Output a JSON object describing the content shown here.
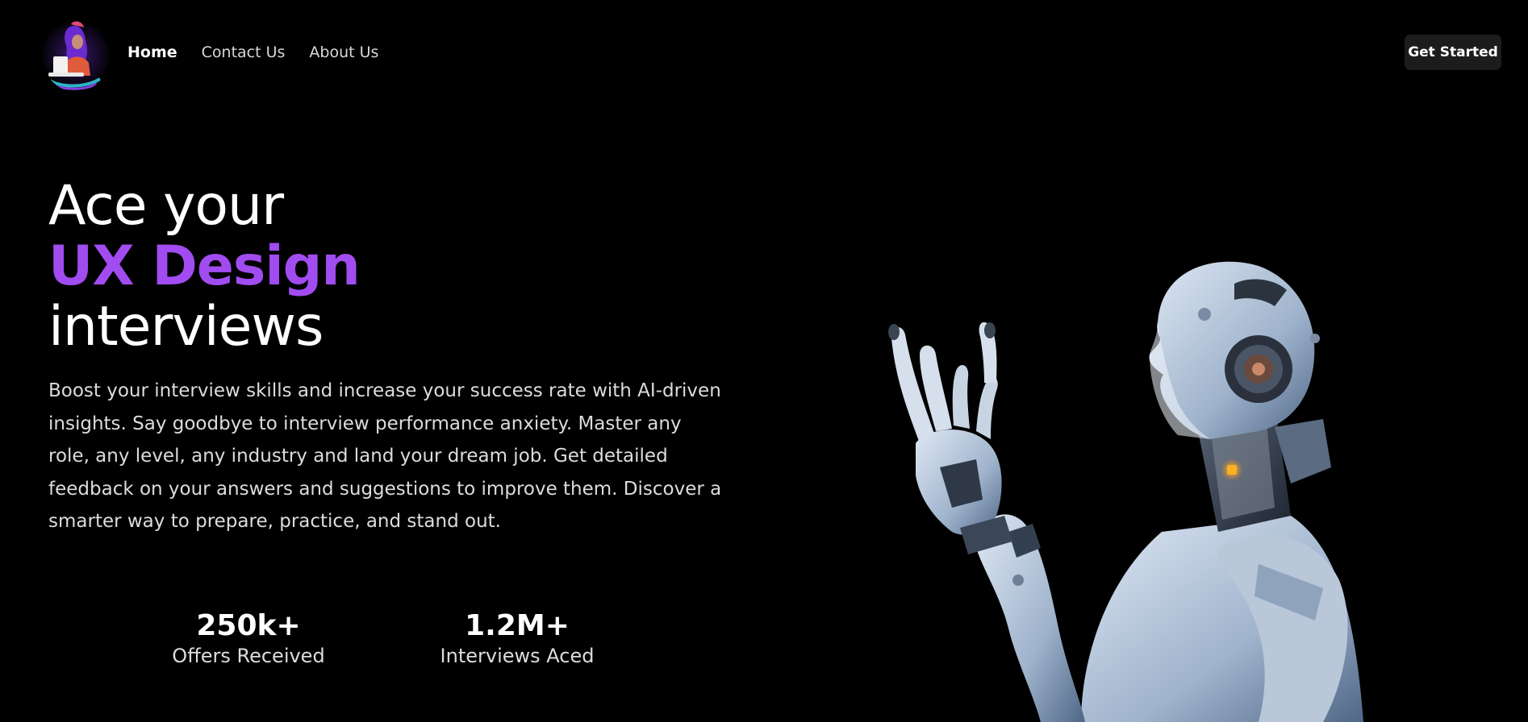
{
  "header": {
    "logo_icon": "woman-at-laptop-logo-icon",
    "nav": [
      {
        "label": "Home",
        "active": true
      },
      {
        "label": "Contact Us",
        "active": false
      },
      {
        "label": "About Us",
        "active": false
      }
    ],
    "cta_label": "Get Started"
  },
  "hero": {
    "headline_line1": "Ace your",
    "headline_line2": "UX Design",
    "headline_line3": "interviews",
    "description": "Boost your interview skills and increase your success rate with AI-driven insights. Say goodbye to interview performance anxiety. Master any role, any level, any industry and land your dream job. Get detailed feedback on your answers and suggestions to improve them. Discover a smarter way to prepare, practice, and stand out."
  },
  "stats": [
    {
      "value": "250k+",
      "label": "Offers Received"
    },
    {
      "value": "1.2M+",
      "label": "Interviews Aced"
    }
  ],
  "illustration": {
    "icon": "humanoid-robot-icon"
  },
  "colors": {
    "background": "#000000",
    "accent": "#a14cf0",
    "button_bg": "#1c1c1c",
    "text": "#ffffff",
    "muted_text": "#dcdcdc"
  }
}
